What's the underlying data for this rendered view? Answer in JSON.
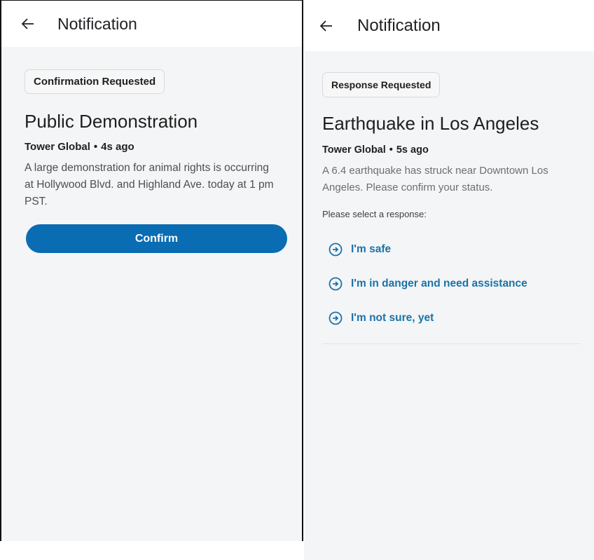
{
  "left_screen": {
    "appbar": {
      "title": "Notification"
    },
    "badge": "Confirmation Requested",
    "headline": "Public Demonstration",
    "source": "Tower Global",
    "separator": "•",
    "time_ago": "4s ago",
    "body": "A large demonstration for animal rights is occurring at Hollywood Blvd. and Highland Ave. today at 1 pm PST.",
    "confirm_label": "Confirm"
  },
  "right_screen": {
    "appbar": {
      "title": "Notification"
    },
    "badge": "Response Requested",
    "headline": "Earthquake in Los Angeles",
    "source": "Tower Global",
    "separator": "•",
    "time_ago": "5s ago",
    "body": "A 6.4 earthquake has struck near Downtown Los Angeles. Please confirm your status.",
    "prompt": "Please select a response:",
    "responses": [
      {
        "label": "I'm safe",
        "icon": "arrow-circle-right-icon"
      },
      {
        "label": "I'm in danger and need assistance",
        "icon": "arrow-circle-right-icon"
      },
      {
        "label": "I'm not sure, yet",
        "icon": "arrow-circle-right-icon"
      }
    ]
  },
  "colors": {
    "accent": "#0a6cb3",
    "link": "#1a73a8",
    "background": "#f4f5f6"
  }
}
